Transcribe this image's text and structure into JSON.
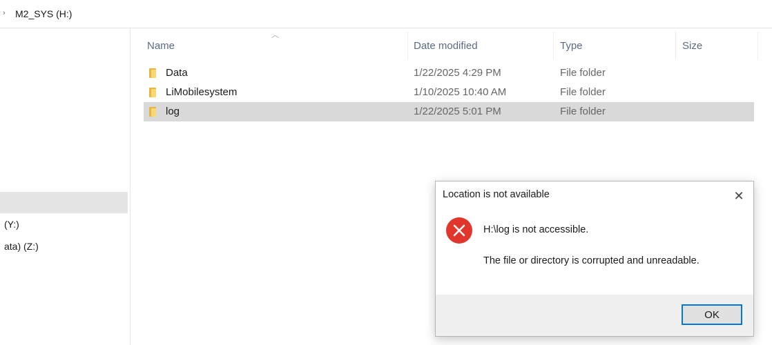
{
  "address_bar": {
    "breadcrumb": "M2_SYS (H:)"
  },
  "nav_pane": {
    "items": [
      "(Y:)",
      "ata) (Z:)"
    ]
  },
  "file_list": {
    "columns": [
      "Name",
      "Date modified",
      "Type",
      "Size"
    ],
    "rows": [
      {
        "name": "Data",
        "date": "1/22/2025 4:29 PM",
        "type": "File folder",
        "size": ""
      },
      {
        "name": "LiMobilesystem",
        "date": "1/10/2025 10:40 AM",
        "type": "File folder",
        "size": ""
      },
      {
        "name": "log",
        "date": "1/22/2025 5:01 PM",
        "type": "File folder",
        "size": ""
      }
    ],
    "selected_row": "log"
  },
  "dialog": {
    "title": "Location is not available",
    "message_primary": "H:\\log is not accessible.",
    "message_secondary": "The file or directory is corrupted and unreadable.",
    "ok_label": "OK",
    "close_glyph": "✕",
    "icon": "error-icon"
  },
  "colors": {
    "error_red": "#e0362c",
    "selection": "#d9d9d9",
    "focus_border": "#0078d7",
    "folder_yellow": "#f8d775"
  }
}
